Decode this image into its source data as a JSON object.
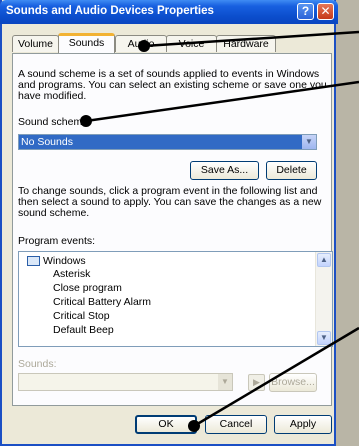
{
  "window": {
    "title": "Sounds and Audio Devices Properties",
    "help_glyph": "?",
    "close_glyph": "✕"
  },
  "tabs": [
    {
      "label": "Volume"
    },
    {
      "label": "Sounds"
    },
    {
      "label": "Audio"
    },
    {
      "label": "Voice"
    },
    {
      "label": "Hardware"
    }
  ],
  "sounds_tab": {
    "intro_lines": [
      "A sound scheme is a set of sounds applied to events in Windows",
      "and programs. You can select an existing scheme or save one you",
      "have modified."
    ],
    "scheme_label": "Sound scheme:",
    "scheme_value": "No Sounds",
    "save_as_label": "Save As...",
    "delete_label": "Delete",
    "change_lines": [
      "To change sounds, click a program event in the following list and",
      "then select a sound to apply. You can save the changes as a new",
      "sound scheme."
    ],
    "events_label": "Program events:",
    "events_root": "Windows",
    "events": [
      "Asterisk",
      "Close program",
      "Critical Battery Alarm",
      "Critical Stop",
      "Default Beep"
    ],
    "sounds_label": "Sounds:",
    "browse_label": "Browse..."
  },
  "footer": {
    "ok_label": "OK",
    "cancel_label": "Cancel",
    "apply_label": "Apply"
  },
  "colors": {
    "title_bar": "#0b4dcc",
    "selection": "#316ac5",
    "dialog_bg": "#ece9d8"
  }
}
